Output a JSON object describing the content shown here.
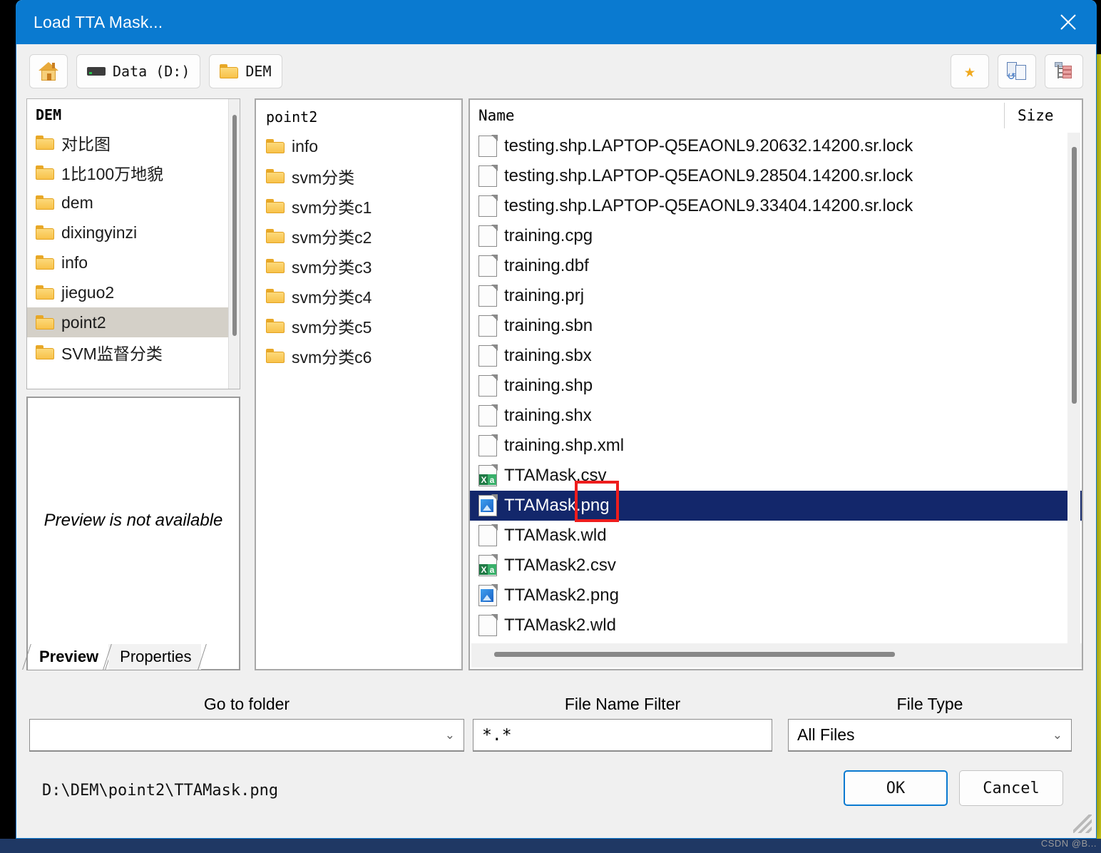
{
  "window": {
    "title": "Load TTA Mask...",
    "close_icon": "close-icon",
    "titlebar_color": "#0a7ad0"
  },
  "toolbar": {
    "home_label": "",
    "home_icon": "home-icon",
    "drive_label": "Data (D:)",
    "drive_icon": "drive-icon",
    "folder_label": "DEM",
    "folder_icon": "folder-icon",
    "favorites_icon": "star-icon",
    "sync_icon": "sync-documents-icon",
    "tree_icon": "tree-view-icon"
  },
  "tree": {
    "root": "DEM",
    "items": [
      {
        "label": "对比图",
        "selected": false
      },
      {
        "label": "1比100万地貌",
        "selected": false
      },
      {
        "label": "dem",
        "selected": false
      },
      {
        "label": "dixingyinzi",
        "selected": false
      },
      {
        "label": "info",
        "selected": false
      },
      {
        "label": "jieguo2",
        "selected": false
      },
      {
        "label": "point2",
        "selected": true
      },
      {
        "label": "SVM监督分类",
        "selected": false
      }
    ]
  },
  "middle": {
    "root": "point2",
    "items": [
      {
        "label": "info"
      },
      {
        "label": "svm分类"
      },
      {
        "label": "svm分类c1"
      },
      {
        "label": "svm分类c2"
      },
      {
        "label": "svm分类c3"
      },
      {
        "label": "svm分类c4"
      },
      {
        "label": "svm分类c5"
      },
      {
        "label": "svm分类c6"
      }
    ]
  },
  "files": {
    "columns": {
      "name": "Name",
      "size": "Size"
    },
    "rows": [
      {
        "name": "testing.shp.LAPTOP-Q5EAONL9.20632.14200.sr.lock",
        "icon": "file-icon",
        "size": "",
        "selected": false
      },
      {
        "name": "testing.shp.LAPTOP-Q5EAONL9.28504.14200.sr.lock",
        "icon": "file-icon",
        "size": "",
        "selected": false
      },
      {
        "name": "testing.shp.LAPTOP-Q5EAONL9.33404.14200.sr.lock",
        "icon": "file-icon",
        "size": "",
        "selected": false
      },
      {
        "name": "training.cpg",
        "icon": "file-icon",
        "size": "",
        "selected": false
      },
      {
        "name": "training.dbf",
        "icon": "file-icon",
        "size": "",
        "selected": false
      },
      {
        "name": "training.prj",
        "icon": "file-icon",
        "size": "",
        "selected": false
      },
      {
        "name": "training.sbn",
        "icon": "file-icon",
        "size": "",
        "selected": false
      },
      {
        "name": "training.sbx",
        "icon": "file-icon",
        "size": "",
        "selected": false
      },
      {
        "name": "training.shp",
        "icon": "file-icon",
        "size": "",
        "selected": false
      },
      {
        "name": "training.shx",
        "icon": "file-icon",
        "size": "",
        "selected": false
      },
      {
        "name": "training.shp.xml",
        "icon": "file-icon",
        "size": "",
        "selected": false
      },
      {
        "name": "TTAMask.csv",
        "icon": "csv-file-icon",
        "size": "",
        "selected": false
      },
      {
        "name": "TTAMask.png",
        "icon": "image-file-icon",
        "size": "",
        "selected": true
      },
      {
        "name": "TTAMask.wld",
        "icon": "file-icon",
        "size": "",
        "selected": false
      },
      {
        "name": "TTAMask2.csv",
        "icon": "csv-file-icon",
        "size": "",
        "selected": false
      },
      {
        "name": "TTAMask2.png",
        "icon": "image-file-icon",
        "size": "",
        "selected": false
      },
      {
        "name": "TTAMask2.wld",
        "icon": "file-icon",
        "size": "",
        "selected": false
      }
    ]
  },
  "preview": {
    "message": "Preview is not available",
    "tabs": [
      {
        "label": "Preview",
        "active": true
      },
      {
        "label": "Properties",
        "active": false
      }
    ]
  },
  "controls": {
    "go_to_folder_label": "Go to folder",
    "go_to_folder_value": "",
    "file_name_filter_label": "File Name Filter",
    "file_name_filter_value": "*.*",
    "file_type_label": "File Type",
    "file_type_value": "All Files",
    "chevron": "∨"
  },
  "footer": {
    "path": "D:\\DEM\\point2\\TTAMask.png",
    "ok_label": "OK",
    "cancel_label": "Cancel"
  },
  "watermark": {
    "text": "CSDN @B..."
  }
}
